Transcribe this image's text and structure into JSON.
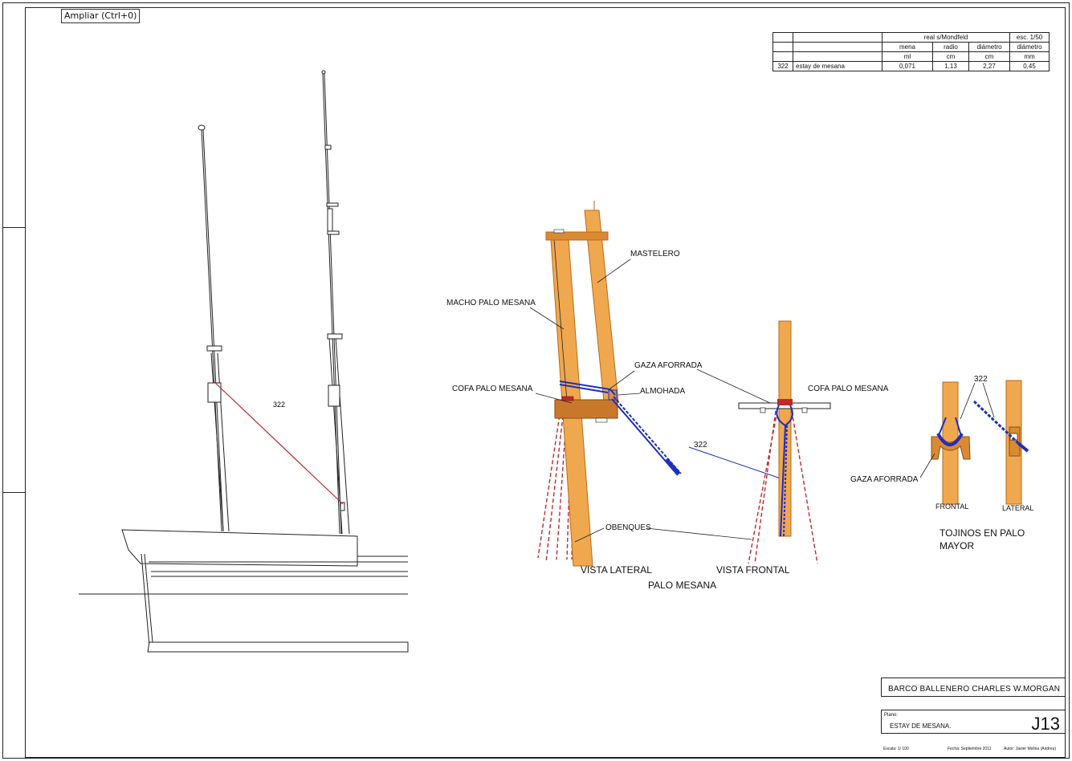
{
  "tooltip": "Ampliar (Ctrl+0)",
  "table": {
    "group_real": "real s/Mondfeld",
    "group_scale": "esc. 1/50",
    "col_mena": "mena",
    "col_radio": "radio",
    "col_diam1": "diámetro",
    "col_diam2": "diámetro",
    "unit_mena": "ml",
    "unit_radio": "cm",
    "unit_diam1": "cm",
    "unit_diam2": "mm",
    "row": {
      "num": "322",
      "name": "estay de mesana",
      "mena": "0,071",
      "radio": "1,13",
      "diam_cm": "2,27",
      "diam_mm": "0,45"
    }
  },
  "labels": {
    "rope_322_left": "322",
    "mastelero": "MASTELERO",
    "macho": "MACHO PALO MESANA",
    "gaza": "GAZA AFORRADA",
    "cofa_lat": "COFA PALO MESANA",
    "almohada": "ALMOHADA",
    "rope_322_mid": "322",
    "cofa_front": "COFA PALO MESANA",
    "obenques": "OBENQUES",
    "vista_lateral": "VISTA LATERAL",
    "vista_frontal": "VISTA FRONTAL",
    "palo_mesana": "PALO MESANA",
    "rope_322_right": "322",
    "gaza_right": "GAZA AFORRADA",
    "frontal": "FRONTAL",
    "lateral": "LATERAL",
    "tojinos_1": "TOJINOS EN PALO",
    "tojinos_2": "MAYOR"
  },
  "title_block": {
    "ship": "BARCO BALLENERO CHARLES W.MORGAN",
    "plano_label": "Plano:",
    "sheet_name": "ESTAY DE MESANA.",
    "sheet_code": "J13",
    "escala": "Escala: 1/ 100",
    "fecha": "Fecha: Septiembre 2011",
    "autor": "Autor: Javier Molina (Andreu)"
  },
  "colors": {
    "wood": "#f0a84e",
    "wood_dark": "#b86a18",
    "rope_red": "#c0282a",
    "rope_blue": "#1c2fbf",
    "line": "#222222"
  }
}
